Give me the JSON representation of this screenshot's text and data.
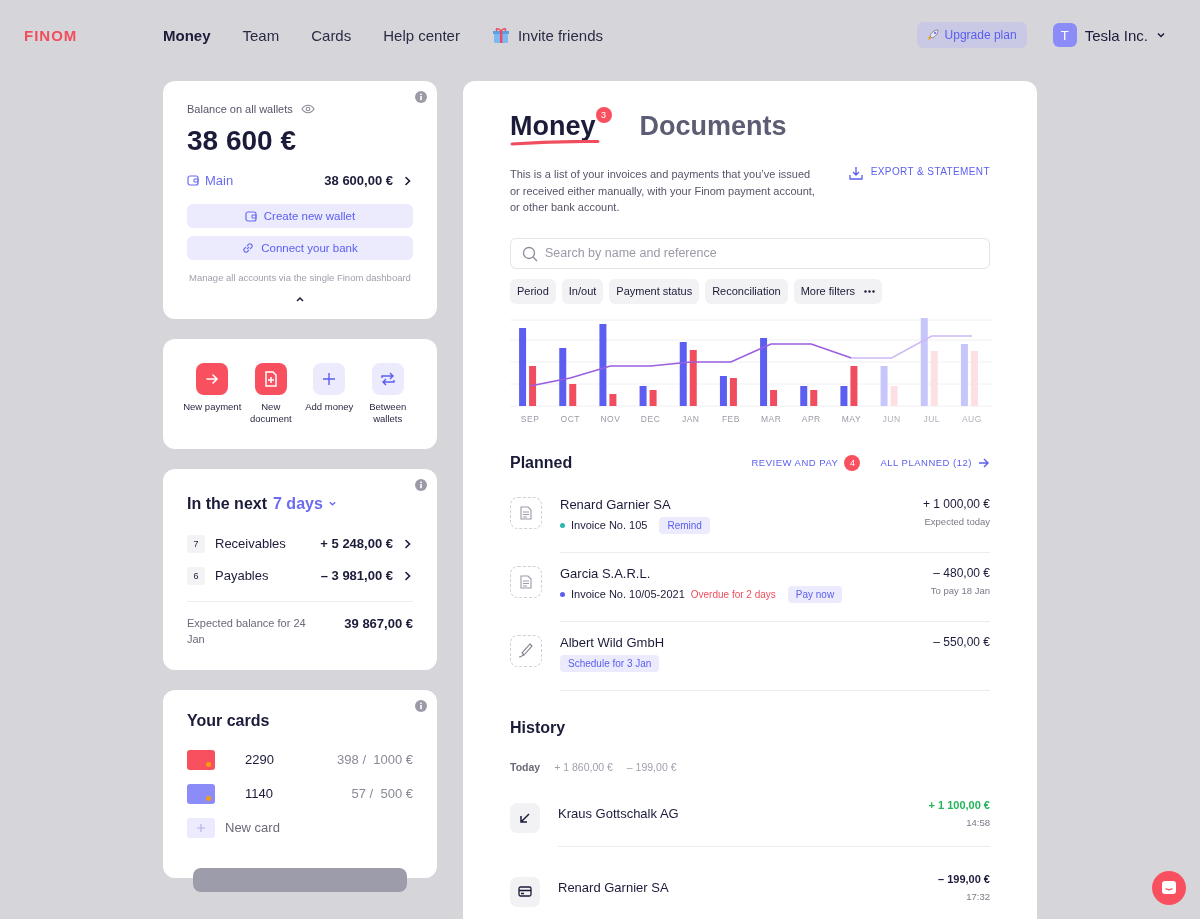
{
  "nav": {
    "logo": "FINOM",
    "items": [
      {
        "label": "Money",
        "selected": true
      },
      {
        "label": "Team",
        "selected": false
      },
      {
        "label": "Cards",
        "selected": false
      },
      {
        "label": "Help center",
        "selected": false
      }
    ],
    "invite": "Invite friends",
    "upgrade": "Upgrade plan",
    "account": {
      "initial": "T",
      "name": "Tesla Inc."
    }
  },
  "balance": {
    "label": "Balance on all wallets",
    "amount": "38 600 €",
    "wallet": {
      "name": "Main",
      "amount": "38 600,00 €"
    },
    "buttons": [
      {
        "kind": "wallet",
        "label": "Create new wallet"
      },
      {
        "kind": "link",
        "label": "Connect your bank"
      }
    ],
    "note": "Manage all accounts via the single Finom dashboard"
  },
  "actions": [
    {
      "kind": "payment",
      "label": "New payment"
    },
    {
      "kind": "document",
      "label": "New document"
    },
    {
      "kind": "add",
      "label": "Add money"
    },
    {
      "kind": "transfer",
      "label": "Between wallets"
    }
  ],
  "forecast": {
    "title": "In the next",
    "period": "7 days",
    "rows": [
      {
        "count": "7",
        "label": "Receivables",
        "amount": "+ 5 248,00 €"
      },
      {
        "count": "6",
        "label": "Payables",
        "amount": "– 3 981,00 €"
      }
    ],
    "expected_label": "Expected balance for 24 Jan",
    "expected_amount": "39 867,00 €"
  },
  "cards": {
    "title": "Your cards",
    "items": [
      {
        "number": "2290",
        "usage": "398 /  1000 €",
        "color": "#f9505f"
      },
      {
        "number": "1140",
        "usage": "57 /  500 €",
        "color": "#8b8cf8"
      }
    ],
    "new_card": "New card"
  },
  "main": {
    "tabs": [
      {
        "label": "Money",
        "selected": true,
        "badge": "3"
      },
      {
        "label": "Documents",
        "selected": false
      }
    ],
    "description": "This is a list of your invoices and payments that you’ve issued or received either manually, with your Finom payment account, or other bank account.",
    "export": "EXPORT & STATEMENT",
    "search": {
      "placeholder": "Search by name and reference"
    },
    "filters": [
      {
        "kind": "plain",
        "label": "Period"
      },
      {
        "kind": "plain",
        "label": "In/out"
      },
      {
        "kind": "plain",
        "label": "Payment status"
      },
      {
        "kind": "plain",
        "label": "Reconciliation"
      },
      {
        "kind": "more",
        "label": "More filters"
      }
    ],
    "months": [
      {
        "label": "SEP",
        "forecast": false
      },
      {
        "label": "OCT",
        "forecast": false
      },
      {
        "label": "NOV",
        "forecast": false
      },
      {
        "label": "DEC",
        "forecast": false
      },
      {
        "label": "JAN",
        "forecast": false
      },
      {
        "label": "FEB",
        "forecast": false
      },
      {
        "label": "MAR",
        "forecast": false
      },
      {
        "label": "APR",
        "forecast": false
      },
      {
        "label": "MAY",
        "forecast": false
      },
      {
        "label": "JUN",
        "forecast": true
      },
      {
        "label": "JUL",
        "forecast": true
      },
      {
        "label": "AUG",
        "forecast": true
      }
    ]
  },
  "planned": {
    "title": "Planned",
    "review": {
      "label": "REVIEW AND PAY",
      "count": "4"
    },
    "all": "ALL PLANNED (12)",
    "rows": [
      {
        "kind": "document",
        "name": "Renard Garnier SA",
        "invoice": "Invoice No. 105",
        "color": "#2bb5b0",
        "overdue": "",
        "action": "Remind",
        "amount": "+ 1 000,00 €",
        "note": "Expected today"
      },
      {
        "kind": "document",
        "name": "Garcia S.A.R.L.",
        "invoice": "Invoice No. 10/05-2021",
        "color": "#5b5ef0",
        "overdue": "Overdue for 2 days",
        "action": "Pay now",
        "amount": "– 480,00 €",
        "note": "To pay 18 Jan"
      },
      {
        "kind": "signature",
        "name": "Albert Wild GmbH",
        "action": "Schedule for 3 Jan",
        "amount": "– 550,00 €"
      }
    ]
  },
  "history": {
    "title": "History",
    "day": {
      "label": "Today",
      "income": "+ 1 860,00 €",
      "outgo": "– 199,00 €"
    },
    "rows": [
      {
        "kind": "incoming",
        "name": "Kraus Gottschalk AG",
        "amount": "+ 1 100,00 €",
        "time": "14:58"
      },
      {
        "kind": "card",
        "name": "Renard Garnier SA",
        "amount": "– 199,00 €",
        "time": "17:32"
      }
    ]
  }
}
